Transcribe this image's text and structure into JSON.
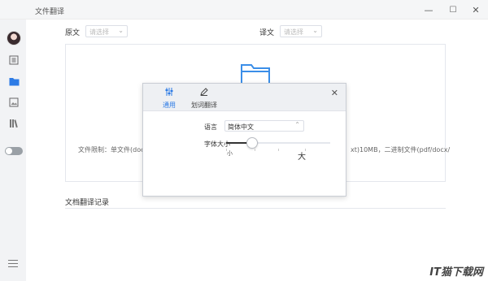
{
  "window": {
    "title": "文件翻译",
    "minimize_glyph": "—",
    "maximize_glyph": "☐",
    "close_glyph": "✕"
  },
  "sidebar": {
    "items": [
      {
        "icon": "avatar"
      },
      {
        "icon": "text-translate-icon"
      },
      {
        "icon": "folder-icon",
        "active": true
      },
      {
        "icon": "image-translate-icon"
      },
      {
        "icon": "library-icon"
      },
      {
        "icon": "toggle-switch",
        "state": "off"
      },
      {
        "icon": "menu-icon"
      }
    ]
  },
  "main": {
    "source_label": "原文",
    "source_placeholder": "请选择",
    "target_label": "译文",
    "target_placeholder": "请选择",
    "dropzone": {
      "limit_text_left": "文件限制：单文件(docx/",
      "limit_text_right": "xt)10MB，二进制文件(pdf/docx/"
    },
    "records_title": "文档翻译记录"
  },
  "settings_modal": {
    "tabs": [
      {
        "label": "通用",
        "icon": "settings-sliders-icon",
        "active": true
      },
      {
        "label": "划词翻译",
        "icon": "pencil-icon",
        "active": false
      }
    ],
    "close_glyph": "✕",
    "language_label": "语言",
    "language_value": "简体中文",
    "font_size_label": "字体大小",
    "font_size_small": "小",
    "font_size_large": "大",
    "font_size_level": 0.25
  },
  "colors": {
    "accent": "#2d7be5",
    "sidebar_bg": "#f2f3f5",
    "folder": "#3b8ee8"
  },
  "watermark": "IT猫下载网"
}
